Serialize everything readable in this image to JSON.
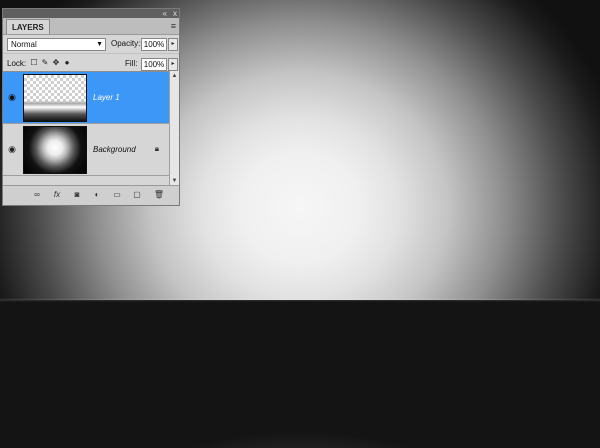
{
  "panel": {
    "tab_label": "LAYERS",
    "collapse_glyph": "«",
    "close_glyph": "x",
    "menu_glyph": "≡",
    "blend_mode": "Normal",
    "opacity_label": "Opacity:",
    "opacity_value": "100%",
    "lock_label": "Lock:",
    "fill_label": "Fill:",
    "fill_value": "100%",
    "layers": [
      {
        "name": "Layer 1",
        "selected": true,
        "visible": true,
        "locked": false
      },
      {
        "name": "Background",
        "selected": false,
        "visible": true,
        "locked": true
      }
    ],
    "bottom_icons": [
      "link-layers-icon",
      "fx-icon",
      "add-mask-icon",
      "adjustment-layer-icon",
      "new-group-icon",
      "new-layer-icon",
      "trash-icon"
    ]
  },
  "colors": {
    "selection_blue": "#3d97f7",
    "panel_gray": "#d6d6d6",
    "canvas_dark": "#111111"
  }
}
